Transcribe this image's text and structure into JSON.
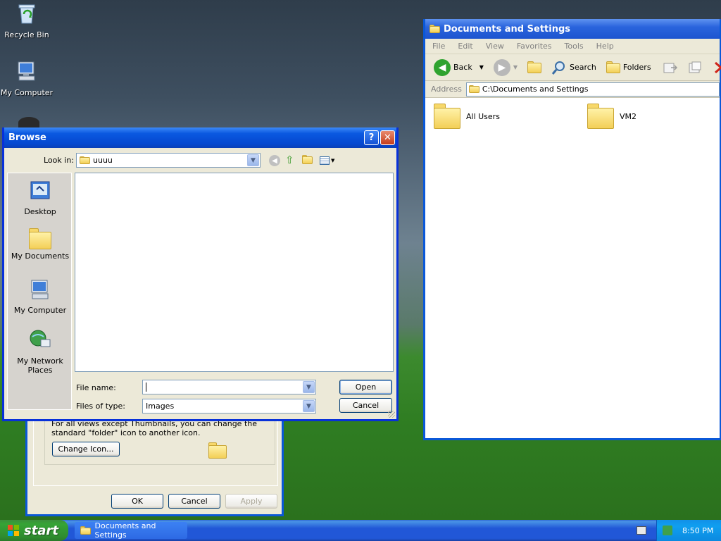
{
  "desktop": {
    "icons": [
      {
        "label": "Recycle Bin"
      },
      {
        "label": "My Computer"
      }
    ]
  },
  "explorer": {
    "title": "Documents and Settings",
    "menu": [
      "File",
      "Edit",
      "View",
      "Favorites",
      "Tools",
      "Help"
    ],
    "toolbar": {
      "back": "Back",
      "search": "Search",
      "folders": "Folders"
    },
    "address_label": "Address",
    "address_value": "C:\\Documents and Settings",
    "items": [
      "All Users",
      "VM2"
    ]
  },
  "properties_dialog": {
    "description": "For all views except Thumbnails, you can change the standard \"folder\" icon to another icon.",
    "change_icon": "Change Icon...",
    "ok": "OK",
    "cancel": "Cancel",
    "apply": "Apply"
  },
  "browse_dialog": {
    "title": "Browse",
    "look_in_label": "Look in:",
    "look_in_value": "uuuu",
    "places": [
      "Desktop",
      "My Documents",
      "My Computer",
      "My Network Places"
    ],
    "file_name_label": "File name:",
    "file_name_value": "",
    "files_of_type_label": "Files of type:",
    "files_of_type_value": "Images",
    "open": "Open",
    "cancel": "Cancel",
    "help_glyph": "?",
    "close_glyph": "✕"
  },
  "taskbar": {
    "start": "start",
    "task": "Documents and Settings",
    "clock": "8:50 PM"
  }
}
